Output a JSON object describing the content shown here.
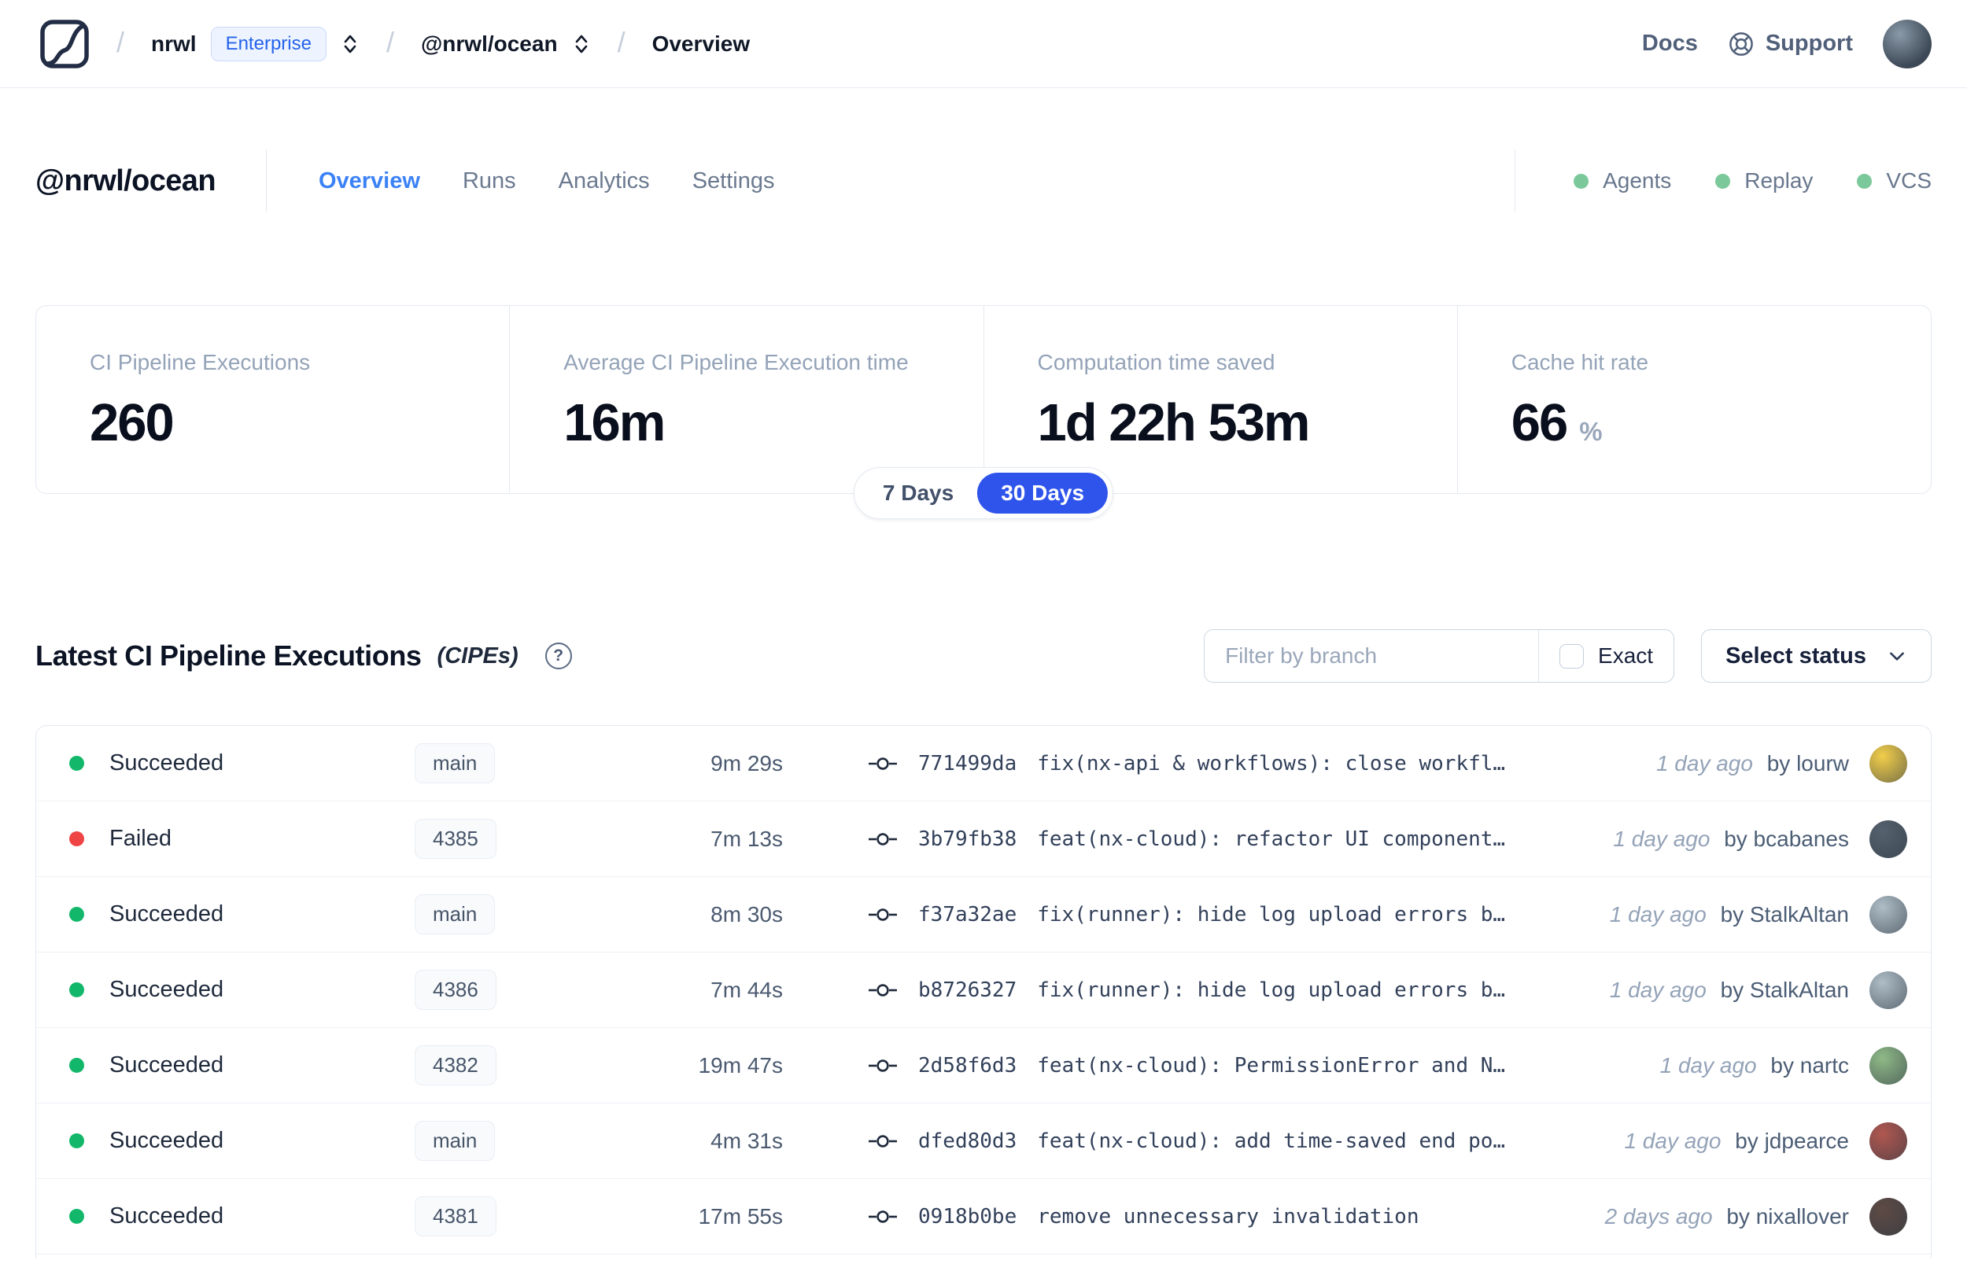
{
  "topbar": {
    "breadcrumb": {
      "org": "nrwl",
      "org_badge": "Enterprise",
      "workspace": "@nrwl/ocean",
      "page": "Overview"
    },
    "links": {
      "docs": "Docs",
      "support": "Support"
    }
  },
  "workspace_header": {
    "title": "@nrwl/ocean",
    "tabs": [
      {
        "label": "Overview",
        "active": true
      },
      {
        "label": "Runs",
        "active": false
      },
      {
        "label": "Analytics",
        "active": false
      },
      {
        "label": "Settings",
        "active": false
      }
    ],
    "statuses": [
      {
        "label": "Agents",
        "color": "#7bc89a"
      },
      {
        "label": "Replay",
        "color": "#7bc89a"
      },
      {
        "label": "VCS",
        "color": "#7bc89a"
      }
    ]
  },
  "stats": {
    "cards": [
      {
        "label": "CI Pipeline Executions",
        "value": "260"
      },
      {
        "label": "Average CI Pipeline Execution time",
        "value": "16m"
      },
      {
        "label": "Computation time saved",
        "value": "1d 22h 53m"
      },
      {
        "label": "Cache hit rate",
        "value": "66",
        "suffix": "%"
      }
    ],
    "range_toggle": {
      "options": [
        "7 Days",
        "30 Days"
      ],
      "selected": "30 Days",
      "selected_color": "#2f54eb"
    }
  },
  "cipe_section": {
    "title": "Latest CI Pipeline Executions",
    "title_suffix": "(CIPEs)",
    "filter": {
      "placeholder": "Filter by branch",
      "exact_label": "Exact"
    },
    "status_select_label": "Select status"
  },
  "table": {
    "rows": [
      {
        "status": "Succeeded",
        "status_color": "#12b76a",
        "branch": "main",
        "duration": "9m 29s",
        "commit_hash": "771499da",
        "commit_message": "fix(nx-api & workflows): close workfl…",
        "time_ago": "1 day ago",
        "author_text": "by lourw",
        "avatar_color": "#f2ce4a"
      },
      {
        "status": "Failed",
        "status_color": "#ef4444",
        "branch": "4385",
        "duration": "7m 13s",
        "commit_hash": "3b79fb38",
        "commit_message": "feat(nx-cloud): refactor UI component…",
        "time_ago": "1 day ago",
        "author_text": "by bcabanes",
        "avatar_color": "#55616e"
      },
      {
        "status": "Succeeded",
        "status_color": "#12b76a",
        "branch": "main",
        "duration": "8m 30s",
        "commit_hash": "f37a32ae",
        "commit_message": "fix(runner): hide log upload errors b…",
        "time_ago": "1 day ago",
        "author_text": "by StalkAltan",
        "avatar_color": "#aebdc6"
      },
      {
        "status": "Succeeded",
        "status_color": "#12b76a",
        "branch": "4386",
        "duration": "7m 44s",
        "commit_hash": "b8726327",
        "commit_message": "fix(runner): hide log upload errors b…",
        "time_ago": "1 day ago",
        "author_text": "by StalkAltan",
        "avatar_color": "#aebdc6"
      },
      {
        "status": "Succeeded",
        "status_color": "#12b76a",
        "branch": "4382",
        "duration": "19m 47s",
        "commit_hash": "2d58f6d3",
        "commit_message": "feat(nx-cloud): PermissionError and N…",
        "time_ago": "1 day ago",
        "author_text": "by nartc",
        "avatar_color": "#8fb987"
      },
      {
        "status": "Succeeded",
        "status_color": "#12b76a",
        "branch": "main",
        "duration": "4m 31s",
        "commit_hash": "dfed80d3",
        "commit_message": "feat(nx-cloud): add time-saved end po…",
        "time_ago": "1 day ago",
        "author_text": "by jdpearce",
        "avatar_color": "#b0574f"
      },
      {
        "status": "Succeeded",
        "status_color": "#12b76a",
        "branch": "4381",
        "duration": "17m 55s",
        "commit_hash": "0918b0be",
        "commit_message": "remove unnecessary invalidation",
        "time_ago": "2 days ago",
        "author_text": "by nixallover",
        "avatar_color": "#5d4a44"
      }
    ]
  }
}
